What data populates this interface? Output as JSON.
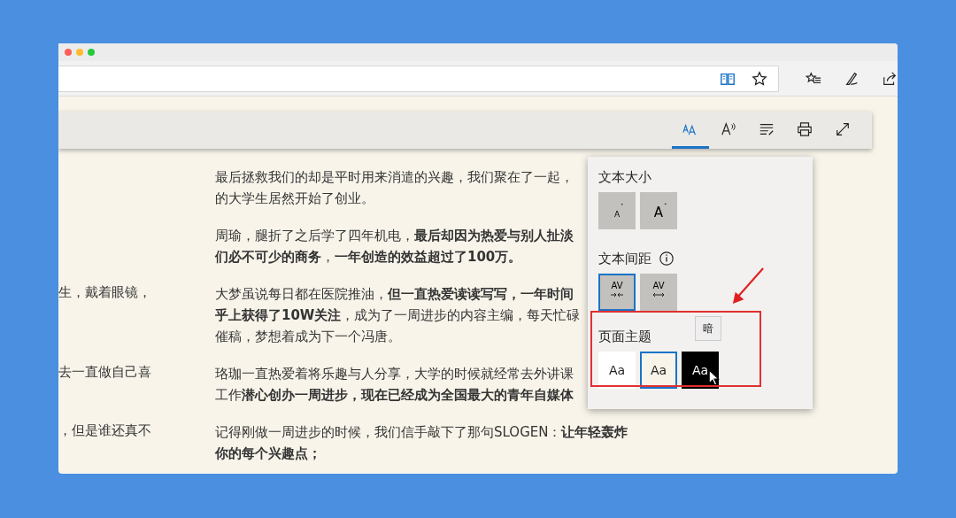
{
  "address_bar": {
    "reading_view_on": true
  },
  "toolbar": {
    "tools": [
      {
        "kind": "text-options",
        "selected": true
      },
      {
        "kind": "read-aloud",
        "selected": false
      },
      {
        "kind": "grammar",
        "selected": false
      },
      {
        "kind": "print",
        "selected": false
      },
      {
        "kind": "fullscreen",
        "selected": false
      }
    ]
  },
  "article": {
    "paragraphs": [
      {
        "lines": [
          "最后拯救我们的却是平时用来消遣的兴趣，我们聚在了一起，",
          "的大学生居然开始了创业。"
        ]
      },
      {
        "lines": [
          "周瑜，腿折了之后学了四年机电，**最后却因为热爱与别人扯淡**",
          "**们必不可少的商务**，**一年创造的效益超过了100万。**"
        ]
      },
      {
        "side": "生，戴着眼镜，",
        "lines": [
          "大梦虽说每日都在医院推油，**但一直热爱读读写写，一年时间**",
          "**乎上获得了10W关注**，成为了一周进步的内容主编，每天忙碌",
          "催稿，梦想着成为下一个冯唐。"
        ]
      },
      {
        "side": "去一直做自己喜",
        "lines": [
          "珞珈一直热爱着将乐趣与人分享，大学的时候就经常去外讲课",
          "工作**潜心创办一周进步，现在已经成为全国最大的青年自媒体**"
        ]
      },
      {
        "side": "，但是谁还真不",
        "lines": [
          "记得刚做一周进步的时候，我们信手敲下了那句SLOGEN：**让年轻轰炸**",
          "**你的每个兴趣点；**"
        ]
      }
    ]
  },
  "text_panel": {
    "sections": [
      {
        "kind": "size",
        "title": "文本大小",
        "info": false,
        "options": [
          {
            "kind": "smaller",
            "label": "A",
            "selected": false
          },
          {
            "kind": "larger",
            "label": "A",
            "selected": false
          }
        ]
      },
      {
        "kind": "spacing",
        "title": "文本间距",
        "info": true,
        "options": [
          {
            "kind": "narrow",
            "label": "AV",
            "selected": true
          },
          {
            "kind": "wide",
            "label": "AV",
            "selected": false
          }
        ]
      },
      {
        "kind": "theme",
        "title": "页面主题",
        "info": false,
        "tooltip": "暗",
        "highlighted": true,
        "options": [
          {
            "kind": "light",
            "label": "Aa",
            "selected": false,
            "color": "#ffffff"
          },
          {
            "kind": "sepia",
            "label": "Aa",
            "selected": true,
            "color": "#f8f4ea"
          },
          {
            "kind": "dark",
            "label": "Aa",
            "selected": false,
            "color": "#000000",
            "hovered": true
          }
        ]
      }
    ]
  }
}
